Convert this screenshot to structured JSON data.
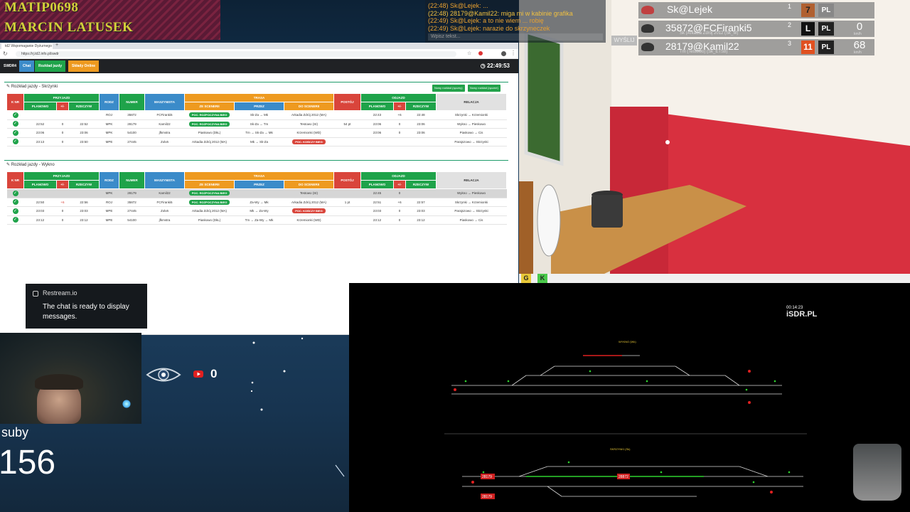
{
  "overlay": {
    "nick1": "MATIP0698",
    "nick2": "MARCIN LATUSEK",
    "subs_label": "suby",
    "subs_count": "156",
    "views_count": "0",
    "restream": {
      "name": "Restream.io",
      "message": "The chat is ready to display messages."
    }
  },
  "game_chat": {
    "lines": [
      {
        "text": "(22:48) Sk@Lejek: ..."
      },
      {
        "text": "(22:48) 28179@Kamil22: miga mi w kabinie grafika"
      },
      {
        "text": "(22:49) Sk@Lejek: a to nie wiem ... robię"
      },
      {
        "text": "(22:49) Sk@Lejek: narazie do skrzyneczek"
      }
    ],
    "input_placeholder": "Wpisz tekst...",
    "send_label": "WYŚLIJ"
  },
  "players": [
    {
      "name": "Sk@Lejek",
      "sub": "",
      "num": "1",
      "level": "7",
      "flag": "PL",
      "speed": "",
      "unit": "",
      "level_color": "#b06030"
    },
    {
      "name": "35872@FCFiranki5",
      "sub": "Sk (Arkadia Zdrój 2012 (Sk_M)",
      "num": "2",
      "level": "L",
      "flag": "PL",
      "speed": "0",
      "unit": "km/h",
      "level_color": "#111111"
    },
    {
      "name": "28179@Kamil22",
      "sub": "Tm (Testowo) (Sk_ETS8)",
      "num": "3",
      "level": "11",
      "flag": "PL",
      "speed": "68",
      "unit": "km/h",
      "level_color": "#e05020"
    }
  ],
  "game_buttons": {
    "g": "G",
    "k": "K"
  },
  "browser": {
    "tab_title": "td2 Wspomaganie Dyżurnego",
    "url": "https://rj.td2.info.pl/swdr",
    "app_name": "SWDR4",
    "btn_chat": "Chat",
    "btn_rozklad": "Rozkład jazdy",
    "btn_sklady": "Składy Online",
    "clock": "22:49:53"
  },
  "sections": [
    {
      "title": "Rozkład jazdy - Skrzynki",
      "btn_new": "Nowy rozkład (ręczny)",
      "btn_new2": "Nowy rozkład (ręczne)",
      "rows": [
        [
          "",
          "",
          "",
          "ROJ",
          "35872",
          "FCFiranki5",
          "POC. ROZPOCZYNA BIEG",
          "Sk-Za → Mk",
          "Arkadia Zdrój 2012 (MA)",
          "",
          "22:43",
          "+6",
          "22:48",
          "Skrzynki → Krzemionki"
        ],
        [
          "22:52",
          "0",
          "22:52",
          "MPK",
          "28179",
          "Kamil22",
          "POC. ROZPOCZYNA BIEG",
          "Sk-Za → Tm",
          "Testowo (SI)",
          "54 pt",
          "23:06",
          "0",
          "23:06",
          "Wykno → Pieskowo"
        ],
        [
          "23:06",
          "0",
          "23:06",
          "MPK",
          "54100",
          "jfkmstra",
          "Piaskowo (DkL)",
          "Tm → Sk-Za → Mk",
          "Krzemionki (WD)",
          "",
          "23:06",
          "0",
          "23:06",
          "Piaskowo → Cis"
        ],
        [
          "23:13",
          "0",
          "23:50",
          "MPE",
          "27445",
          "Zolv6",
          "Arkadia Zdrój 2012 (MA)",
          "Mk → Sk-Za",
          "POC. KOŃCZY BIEG",
          "",
          "",
          "",
          "",
          "Parajszowo → Skrzynki"
        ]
      ]
    },
    {
      "title": "Rozkład jazdy - Wykno",
      "rows": [
        [
          "",
          "",
          "",
          "MPK",
          "28179",
          "Kamil22",
          "POC. ROZPOCZYNA BIEG",
          "",
          "Testowo (SI)",
          "",
          "22:45",
          "0",
          "",
          "Wykno → Pieskowo"
        ],
        [
          "22:50",
          "+6",
          "22:56",
          "ROJ",
          "35872",
          "FCFiranki5",
          "POC. ROZPOCZYNA BIEG",
          "Za-Wy → Mk",
          "Arkadia Zdrój 2012 (MA)",
          "1 pt",
          "22:51",
          "+6",
          "22:57",
          "Skrzynki → Krzemionki"
        ],
        [
          "23:03",
          "0",
          "23:03",
          "MPE",
          "27445",
          "Zolv6",
          "Arkadia Zdrój 2012 (MA)",
          "Mk → Za-Wy",
          "POC. KOŃCZY BIEG",
          "",
          "23:03",
          "0",
          "23:03",
          "Parajszowo → Skrzynki"
        ],
        [
          "23:12",
          "0",
          "23:12",
          "MPE",
          "54100",
          "jfkmstra",
          "Piaskowo (DkL)",
          "Tm → Za-Wy → Mk",
          "Krzemionki (WD)",
          "",
          "23:12",
          "0",
          "23:12",
          "Piaskowo → Cis"
        ]
      ]
    }
  ],
  "table_headers": {
    "nr": "K NR",
    "przyjazd": "PRZYJAZD",
    "odjazd": "ODJAZD",
    "planowo": "PLANOWO",
    "opoz": "+/-",
    "rzeczyw": "RZECZYW",
    "rodz": "RODZ",
    "numer": "NUMER",
    "maszynista": "MASZYNISTA",
    "trasa": "TRASA",
    "ze_sceneri": "ZE SCENERII",
    "przez": "PRZEZ",
    "do_sceneri": "DO SCENERII",
    "postoj": "POSTÓJ",
    "relacja": "RELACJA"
  },
  "rail": {
    "isdr_time": "00:14:23",
    "isdr_label": "iSDR.PL",
    "station_top": "WYKNO (Wk)",
    "station_bottom": "SKRZYNKI (Sk)",
    "train_tags": [
      "28179",
      "28872",
      "28179"
    ]
  }
}
